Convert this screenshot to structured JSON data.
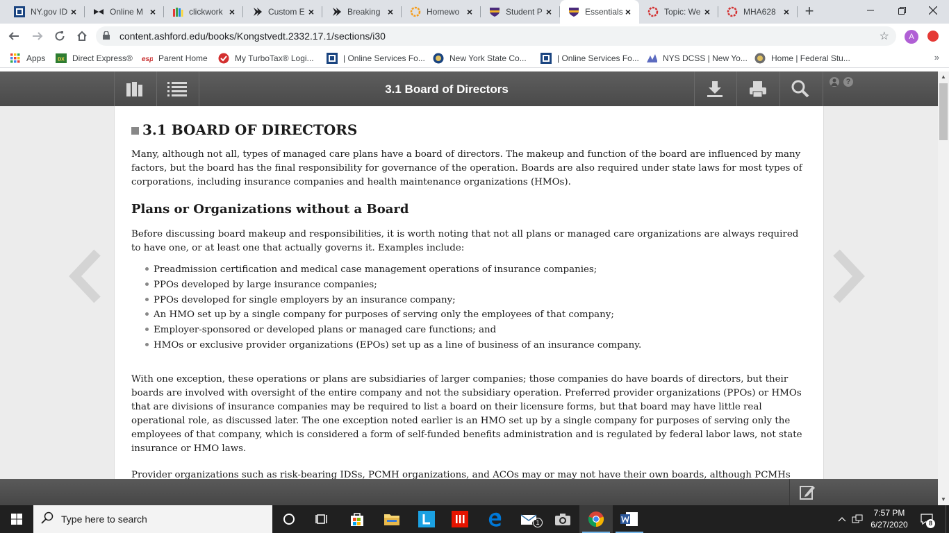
{
  "browser": {
    "tabs": [
      {
        "title": "NY.gov ID",
        "favicon_color": "#1a4480",
        "favicon": "square"
      },
      {
        "title": "Online M",
        "favicon_color": "#202124",
        "favicon": "bow"
      },
      {
        "title": "clickwork",
        "favicon_color": "#e8a33d",
        "favicon": "people"
      },
      {
        "title": "Custom E",
        "favicon_color": "#202124",
        "favicon": "chevron"
      },
      {
        "title": "Breaking",
        "favicon_color": "#202124",
        "favicon": "chevron"
      },
      {
        "title": "Homewo",
        "favicon_color": "#f59c1a",
        "favicon": "ring"
      },
      {
        "title": "Student P",
        "favicon_color": "#f0b323",
        "favicon": "shield"
      },
      {
        "title": "Essentials",
        "favicon_color": "#f0b323",
        "favicon": "shield"
      },
      {
        "title": "Topic: We",
        "favicon_color": "#d32f2f",
        "favicon": "ring"
      },
      {
        "title": "MHA628",
        "favicon_color": "#d32f2f",
        "favicon": "ring"
      }
    ],
    "active_tab": 7,
    "url": "content.ashford.edu/books/Kongstvedt.2332.17.1/sections/i30",
    "profile_initial": "A"
  },
  "bookmarks": [
    {
      "label": "Apps",
      "icon": "apps-grid-icon",
      "color": "#4285f4"
    },
    {
      "label": "Direct Express®",
      "icon": "DX",
      "color": "#2e7d32"
    },
    {
      "label": "Parent Home",
      "icon": "esp",
      "color": "#c62828"
    },
    {
      "label": "My TurboTax® Logi...",
      "icon": "check",
      "color": "#d32f2f"
    },
    {
      "label": "| Online Services Fo...",
      "icon": "ny",
      "color": "#1a4480"
    },
    {
      "label": "New York State Co...",
      "icon": "seal",
      "color": "#1a4480"
    },
    {
      "label": "| Online Services Fo...",
      "icon": "ny",
      "color": "#1a4480"
    },
    {
      "label": "NYS DCSS | New Yo...",
      "icon": "people",
      "color": "#5c6bc0"
    },
    {
      "label": "Home | Federal Stu...",
      "icon": "seal",
      "color": "#6d6d6d"
    }
  ],
  "reader": {
    "title": "3.1 Board of Directors"
  },
  "content": {
    "chapter_title": "3.1 Board of Directors",
    "intro": "Many, although not all, types of managed care plans have a board of directors. The makeup and function of the board are influenced by many factors, but the board has the final responsibility for governance of the operation. Boards are also required under state laws for most types of corporations, including insurance companies and health maintenance organizations (HMOs).",
    "section_heading": "Plans or Organizations without a Board",
    "section_intro": "Before discussing board makeup and responsibilities, it is worth noting that not all plans or managed care organizations are always required to have one, or at least one that actually governs it. Examples include:",
    "examples": [
      "Preadmission certification and medical case management operations of insurance companies;",
      "PPOs developed by large insurance companies;",
      "PPOs developed for single employers by an insurance company;",
      "An HMO set up by a single company for purposes of serving only the employees of that company;",
      "Employer-sponsored or developed plans or managed care functions; and",
      "HMOs or exclusive provider organizations (EPOs) set up as a line of business of an insurance company."
    ],
    "exception_para": "With one exception, these operations or plans are subsidiaries of larger companies; those companies do have boards of directors, but their boards are involved with oversight of the entire company and not the subsidiary operation. Preferred provider organizations (PPOs) or HMOs that are divisions of insurance companies may be required to list a board on their licensure forms, but that board may have little real operational role, as discussed later. The one exception noted earlier is an HMO set up by a single company for purposes of serving only the employees of that company, which is considered a form of self-funded benefits administration and is regulated by federal labor laws, not state insurance or HMO laws.",
    "cut_para": "Provider organizations such as risk-bearing IDSs, PCMH organizations, and ACOs may or may not have their own boards, although PCMHs"
  },
  "taskbar": {
    "search_placeholder": "Type here to search",
    "time": "7:57 PM",
    "date": "6/27/2020",
    "mail_badge": "1",
    "notification_count": "8"
  }
}
